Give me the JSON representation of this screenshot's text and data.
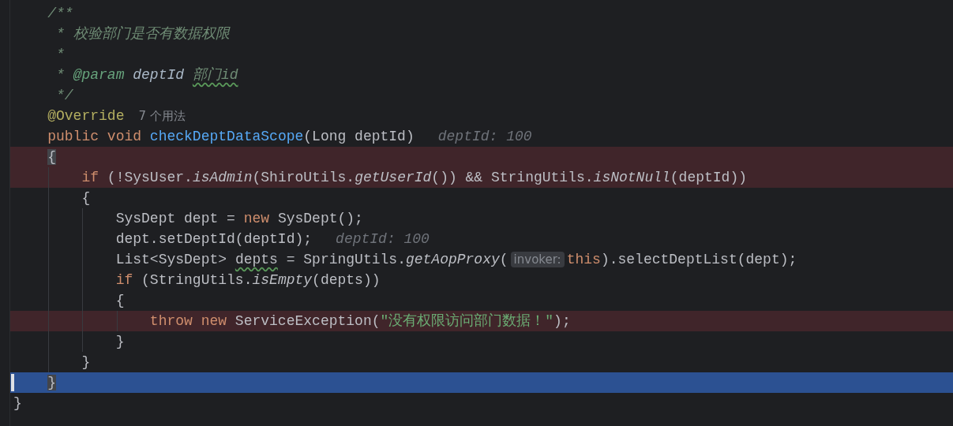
{
  "editor": {
    "lines": [
      {
        "breakpoint": false,
        "current": false,
        "tokens": [
          {
            "kind": "comment",
            "text": "    /**"
          }
        ]
      },
      {
        "breakpoint": false,
        "current": false,
        "tokens": [
          {
            "kind": "comment",
            "text": "     * 校验部门是否有数据权限"
          }
        ]
      },
      {
        "breakpoint": false,
        "current": false,
        "tokens": [
          {
            "kind": "comment",
            "text": "     *"
          }
        ]
      },
      {
        "breakpoint": false,
        "current": false,
        "tokens": [
          {
            "kind": "comment",
            "text": "     * "
          },
          {
            "kind": "doctag",
            "text": "@param"
          },
          {
            "kind": "docparam",
            "text": " deptId "
          },
          {
            "kind": "comment",
            "text": "部门id",
            "typo": true
          }
        ]
      },
      {
        "breakpoint": false,
        "current": false,
        "tokens": [
          {
            "kind": "comment",
            "text": "     */"
          }
        ]
      },
      {
        "breakpoint": false,
        "current": false,
        "tokens": [
          {
            "kind": "annotation",
            "text": "    @Override"
          },
          {
            "kind": "usage",
            "text": "7 个用法"
          }
        ]
      },
      {
        "breakpoint": false,
        "current": false,
        "tokens": [
          {
            "kind": "keyword",
            "text": "    public void "
          },
          {
            "kind": "fn",
            "text": "checkDeptDataScope"
          },
          {
            "kind": "plain",
            "text": "(Long deptId)"
          },
          {
            "kind": "hint",
            "text": "deptId: 100"
          }
        ]
      },
      {
        "breakpoint": true,
        "current": false,
        "tokens": [
          {
            "kind": "plain",
            "text": "    {",
            "matched": true
          }
        ]
      },
      {
        "breakpoint": true,
        "current": false,
        "tokens": [
          {
            "kind": "keyword",
            "text": "        if "
          },
          {
            "kind": "plain",
            "text": "(!SysUser."
          },
          {
            "kind": "static",
            "text": "isAdmin"
          },
          {
            "kind": "plain",
            "text": "(ShiroUtils."
          },
          {
            "kind": "static",
            "text": "getUserId"
          },
          {
            "kind": "plain",
            "text": "()) && StringUtils."
          },
          {
            "kind": "static",
            "text": "isNotNull"
          },
          {
            "kind": "plain",
            "text": "(deptId))"
          }
        ]
      },
      {
        "breakpoint": false,
        "current": false,
        "tokens": [
          {
            "kind": "plain",
            "text": "        {"
          }
        ]
      },
      {
        "breakpoint": false,
        "current": false,
        "tokens": [
          {
            "kind": "plain",
            "text": "            SysDept dept = "
          },
          {
            "kind": "keyword",
            "text": "new "
          },
          {
            "kind": "plain",
            "text": "SysDept();"
          }
        ]
      },
      {
        "breakpoint": false,
        "current": false,
        "tokens": [
          {
            "kind": "plain",
            "text": "            dept.setDeptId(deptId);"
          },
          {
            "kind": "hint",
            "text": "deptId: 100"
          }
        ]
      },
      {
        "breakpoint": false,
        "current": false,
        "tokens": [
          {
            "kind": "plain",
            "text": "            List<SysDept> "
          },
          {
            "kind": "plain",
            "text": "depts",
            "typo": true
          },
          {
            "kind": "plain",
            "text": " = SpringUtils."
          },
          {
            "kind": "static",
            "text": "getAopProxy"
          },
          {
            "kind": "plain",
            "text": "("
          },
          {
            "kind": "inlay",
            "text": "invoker:"
          },
          {
            "kind": "keyword",
            "text": "this"
          },
          {
            "kind": "plain",
            "text": ").selectDeptList(dept);"
          }
        ]
      },
      {
        "breakpoint": false,
        "current": false,
        "tokens": [
          {
            "kind": "keyword",
            "text": "            if "
          },
          {
            "kind": "plain",
            "text": "(StringUtils."
          },
          {
            "kind": "static",
            "text": "isEmpty"
          },
          {
            "kind": "plain",
            "text": "(depts))"
          }
        ]
      },
      {
        "breakpoint": false,
        "current": false,
        "tokens": [
          {
            "kind": "plain",
            "text": "            {"
          }
        ]
      },
      {
        "breakpoint": true,
        "current": false,
        "tokens": [
          {
            "kind": "keyword",
            "text": "                throw new "
          },
          {
            "kind": "plain",
            "text": "ServiceException("
          },
          {
            "kind": "string",
            "text": "\"没有权限访问部门数据！\""
          },
          {
            "kind": "plain",
            "text": ");"
          }
        ]
      },
      {
        "breakpoint": false,
        "current": false,
        "tokens": [
          {
            "kind": "plain",
            "text": "            }"
          }
        ]
      },
      {
        "breakpoint": false,
        "current": false,
        "tokens": [
          {
            "kind": "plain",
            "text": "        }"
          }
        ]
      },
      {
        "breakpoint": false,
        "current": true,
        "tokens": [
          {
            "kind": "plain",
            "text": "    }",
            "matched": true
          }
        ]
      },
      {
        "breakpoint": false,
        "current": false,
        "tokens": [
          {
            "kind": "plain",
            "text": "}"
          }
        ]
      }
    ]
  }
}
